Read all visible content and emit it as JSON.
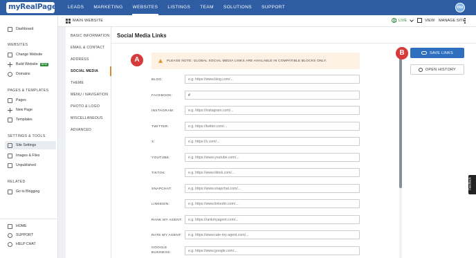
{
  "brand": {
    "logo_text": "myRealPage",
    "avatar_initials": "mv"
  },
  "topnav": {
    "items": [
      "LEADS",
      "MARKETING",
      "WEBSITES",
      "LISTINGS",
      "TEAM",
      "SOLUTIONS",
      "SUPPORT"
    ],
    "active": "WEBSITES"
  },
  "subbar": {
    "site_label": "MAIN WEBSITE",
    "status": "LIVE",
    "view": "VIEW",
    "manage": "MANAGE SITE"
  },
  "sidebar": {
    "dashboard": "Dashboard",
    "websites_heading": "WEBSITES",
    "change_website": "Change Website",
    "build_website": "Build Website",
    "new_badge": "NEW",
    "domains": "Domains",
    "pages_heading": "PAGES & TEMPLATES",
    "pages": "Pages",
    "new_page": "New Page",
    "templates": "Templates",
    "settings_heading": "SETTINGS & TOOLS",
    "site_settings": "Site Settings",
    "images_files": "Images & Files",
    "unpublished": "Unpublished",
    "related_heading": "RELATED",
    "blogging": "Go to Blogging",
    "home": "HOME",
    "support": "SUPPORT",
    "help_chat": "HELP CHAT"
  },
  "settings_menu": {
    "items": [
      "BASIC INFORMATION",
      "EMAIL & CONTACT",
      "ADDRESS",
      "SOCIAL MEDIA",
      "THEME",
      "MENU / NAVIGATION",
      "PHOTO & LOGO",
      "MISCELLANEOUS",
      "ADVANCED"
    ],
    "active": "SOCIAL MEDIA"
  },
  "main": {
    "title": "Social Media Links",
    "notice": "PLEASE NOTE: GLOBAL SOCIAL MEDIA LINKS ARE AVAILABLE IN COMPATIBLE BLOCKS ONLY.",
    "fields": [
      {
        "label": "BLOG:",
        "value": "",
        "placeholder": "e.g. https://www.blog.com/..."
      },
      {
        "label": "FACEBOOK:",
        "value": "#",
        "placeholder": ""
      },
      {
        "label": "INSTAGRAM:",
        "value": "",
        "placeholder": "e.g. https://instagram.com/..."
      },
      {
        "label": "TWITTER:",
        "value": "",
        "placeholder": "e.g. https://twitter.com/..."
      },
      {
        "label": "X:",
        "value": "",
        "placeholder": "e.g. https://x.com/..."
      },
      {
        "label": "YOUTUBE:",
        "value": "",
        "placeholder": "e.g. https://www.youtube.com/..."
      },
      {
        "label": "TIKTOK:",
        "value": "",
        "placeholder": "e.g. https://www.tiktok.com/..."
      },
      {
        "label": "SNAPCHAT:",
        "value": "",
        "placeholder": "e.g. https://www.snapchat.com/..."
      },
      {
        "label": "LINKEDIN:",
        "value": "",
        "placeholder": "e.g. https://www.linkedin.com/..."
      },
      {
        "label": "RANK MY AGENT:",
        "value": "",
        "placeholder": "e.g. https://rankmyagent.com/..."
      },
      {
        "label": "RATE MY AGENT:",
        "value": "",
        "placeholder": "e.g. https://www.rate-my-agent.com/..."
      },
      {
        "label": "GOOGLE BUSINESS:",
        "value": "",
        "placeholder": "e.g. https://www.google.com/..."
      }
    ],
    "save_label": "SAVE LINKS",
    "history_label": "OPEN HISTORY"
  },
  "markers": {
    "a": "A",
    "b": "B"
  },
  "feedback_tab": "Feedback",
  "colors": {
    "nav": "#2f5da3",
    "primary_button": "#2f6fbf",
    "live": "#2e8f3d",
    "marker": "#d63a3a",
    "notice_bg": "#fdf1e4",
    "active_tab": "#d98a24"
  }
}
